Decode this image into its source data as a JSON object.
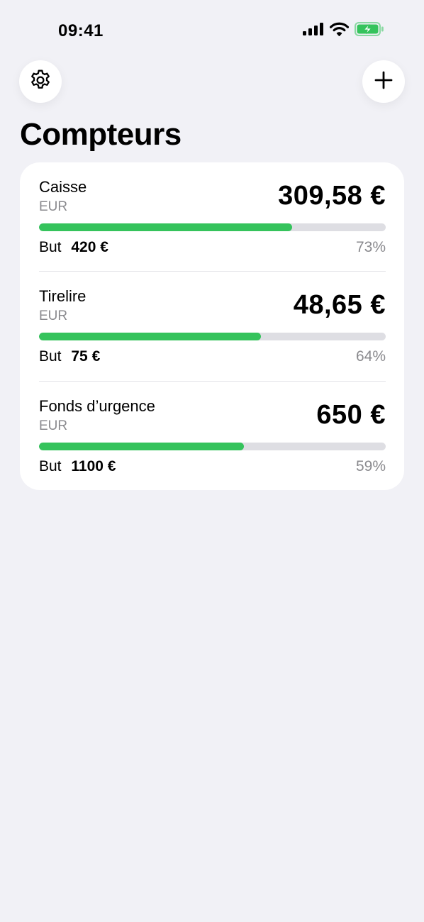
{
  "status_bar": {
    "time": "09:41",
    "icons": [
      "cellular-signal-icon",
      "wifi-icon",
      "battery-charging-icon"
    ],
    "battery_color": "#35c35c"
  },
  "toolbar": {
    "settings_icon": "gear-icon",
    "add_icon": "plus-icon"
  },
  "page": {
    "title": "Compteurs"
  },
  "colors": {
    "background": "#f1f1f6",
    "card": "#ffffff",
    "progress_fill": "#35c35c",
    "progress_track": "#dedee3",
    "secondary_text": "#8a8a8e"
  },
  "counters": [
    {
      "name": "Caisse",
      "currency": "EUR",
      "value": "309,58 €",
      "goal_label": "But",
      "goal": "420 €",
      "percent": "73%",
      "progress": 0.73
    },
    {
      "name": "Tirelire",
      "currency": "EUR",
      "value": "48,65 €",
      "goal_label": "But",
      "goal": "75 €",
      "percent": "64%",
      "progress": 0.64
    },
    {
      "name": "Fonds d’urgence",
      "currency": "EUR",
      "value": "650 €",
      "goal_label": "But",
      "goal": "1100 €",
      "percent": "59%",
      "progress": 0.59
    }
  ]
}
